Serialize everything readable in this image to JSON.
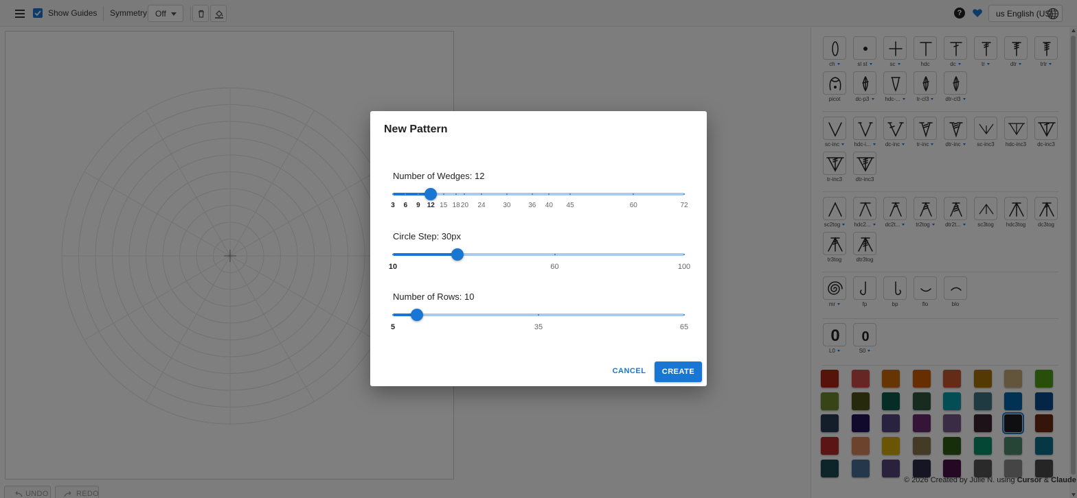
{
  "toolbar": {
    "show_guides_label": "Show Guides",
    "show_guides_checked": true,
    "symmetry_label": "Symmetry:",
    "symmetry_value": "Off",
    "help_label": "?",
    "language_label": "us English (US)"
  },
  "history": {
    "undo_label": "UNDO",
    "redo_label": "REDO"
  },
  "stitch_groups": [
    [
      {
        "label": "ch",
        "dropdown": true,
        "icon": "chain-icon"
      },
      {
        "label": "sl st",
        "dropdown": true,
        "icon": "slip-stitch-icon"
      },
      {
        "label": "sc",
        "dropdown": true,
        "icon": "single-crochet-icon"
      },
      {
        "label": "hdc",
        "dropdown": false,
        "icon": "half-double-crochet-icon"
      },
      {
        "label": "dc",
        "dropdown": true,
        "icon": "double-crochet-icon"
      },
      {
        "label": "tr",
        "dropdown": true,
        "icon": "treble-icon"
      },
      {
        "label": "dtr",
        "dropdown": true,
        "icon": "double-treble-icon"
      },
      {
        "label": "trtr",
        "dropdown": true,
        "icon": "triple-treble-icon"
      },
      {
        "label": "picot",
        "dropdown": false,
        "icon": "picot-icon"
      },
      {
        "label": "dc-p3",
        "dropdown": true,
        "icon": "dc-p3-icon"
      },
      {
        "label": "hdc-...",
        "dropdown": true,
        "icon": "hdc-cluster-icon"
      },
      {
        "label": "tr-cl3",
        "dropdown": true,
        "icon": "tr-cl3-icon"
      },
      {
        "label": "dtr-cl3",
        "dropdown": true,
        "icon": "dtr-cl3-icon"
      }
    ],
    [
      {
        "label": "sc-inc",
        "dropdown": true,
        "icon": "sc-inc-icon"
      },
      {
        "label": "hdc-i...",
        "dropdown": true,
        "icon": "hdc-inc-icon"
      },
      {
        "label": "dc-inc",
        "dropdown": true,
        "icon": "dc-inc-icon"
      },
      {
        "label": "tr-inc",
        "dropdown": true,
        "icon": "tr-inc-icon"
      },
      {
        "label": "dtr-inc",
        "dropdown": true,
        "icon": "dtr-inc-icon"
      },
      {
        "label": "sc-inc3",
        "dropdown": false,
        "icon": "sc-inc3-icon"
      },
      {
        "label": "hdc-inc3",
        "dropdown": false,
        "icon": "hdc-inc3-icon"
      },
      {
        "label": "dc-inc3",
        "dropdown": false,
        "icon": "dc-inc3-icon"
      },
      {
        "label": "tr-inc3",
        "dropdown": false,
        "icon": "tr-inc3-icon"
      },
      {
        "label": "dtr-inc3",
        "dropdown": false,
        "icon": "dtr-inc3-icon"
      }
    ],
    [
      {
        "label": "sc2tog",
        "dropdown": true,
        "icon": "sc2tog-icon"
      },
      {
        "label": "hdc2...",
        "dropdown": true,
        "icon": "hdc2tog-icon"
      },
      {
        "label": "dc2t...",
        "dropdown": true,
        "icon": "dc2tog-icon"
      },
      {
        "label": "tr2tog",
        "dropdown": true,
        "icon": "tr2tog-icon"
      },
      {
        "label": "dtr2t...",
        "dropdown": true,
        "icon": "dtr2tog-icon"
      },
      {
        "label": "sc3tog",
        "dropdown": false,
        "icon": "sc3tog-icon"
      },
      {
        "label": "hdc3tog",
        "dropdown": false,
        "icon": "hdc3tog-icon"
      },
      {
        "label": "dc3tog",
        "dropdown": false,
        "icon": "dc3tog-icon"
      },
      {
        "label": "tr3tog",
        "dropdown": false,
        "icon": "tr3tog-icon"
      },
      {
        "label": "dtr3tog",
        "dropdown": false,
        "icon": "dtr3tog-icon"
      }
    ],
    [
      {
        "label": "mr",
        "dropdown": true,
        "icon": "magic-ring-icon"
      },
      {
        "label": "fp",
        "dropdown": false,
        "icon": "front-post-icon"
      },
      {
        "label": "bp",
        "dropdown": false,
        "icon": "back-post-icon"
      },
      {
        "label": "flo",
        "dropdown": false,
        "icon": "front-loop-icon"
      },
      {
        "label": "blo",
        "dropdown": false,
        "icon": "back-loop-icon"
      }
    ],
    [
      {
        "label": "L0",
        "dropdown": true,
        "icon": "row-label-icon",
        "glyph": "0"
      },
      {
        "label": "S0",
        "dropdown": true,
        "icon": "stitch-label-icon",
        "glyph": "0"
      }
    ]
  ],
  "palette": {
    "colors": [
      "#ab2617",
      "#cc4f49",
      "#cf6a09",
      "#cf5c05",
      "#c9562e",
      "#a87208",
      "#c7ab76",
      "#519d19",
      "#6f8a2c",
      "#4f5218",
      "#0a5a4a",
      "#2e5640",
      "#0a9aa8",
      "#3e7682",
      "#0265a6",
      "#0a4a8e",
      "#293a55",
      "#231458",
      "#53477f",
      "#6a2a6e",
      "#75598a",
      "#3a2430",
      "#1f1f25",
      "#6a2814",
      "#b62a2a",
      "#d9885a",
      "#d5aa0a",
      "#87764a",
      "#2e5c16",
      "#0b8f6a",
      "#4f8a6e",
      "#0a6e8a",
      "#1a4a52",
      "#4a6e94",
      "#54427a",
      "#2a2a48",
      "#4a1048",
      "#555555",
      "#8a8a8a",
      "#4a4a4a"
    ],
    "selected_index": 22
  },
  "credit": {
    "prefix": "© 2026 Created by Julie N. using ",
    "tool1": "Cursor",
    "amp": " & ",
    "tool2": "Claude"
  },
  "dialog": {
    "title": "New Pattern",
    "wedges": {
      "label": "Number of Wedges: 12",
      "value": 12,
      "min": 3,
      "max": 72,
      "marks": [
        3,
        6,
        9,
        12,
        15,
        18,
        20,
        24,
        30,
        36,
        40,
        45,
        60,
        72
      ]
    },
    "circle_step": {
      "label": "Circle Step: 30px",
      "value": 30,
      "min": 10,
      "max": 100,
      "marks": [
        10,
        60,
        100
      ]
    },
    "rows": {
      "label": "Number of Rows: 10",
      "value": 10,
      "min": 5,
      "max": 65,
      "marks": [
        5,
        35,
        65
      ]
    },
    "cancel_label": "CANCEL",
    "create_label": "CREATE"
  }
}
